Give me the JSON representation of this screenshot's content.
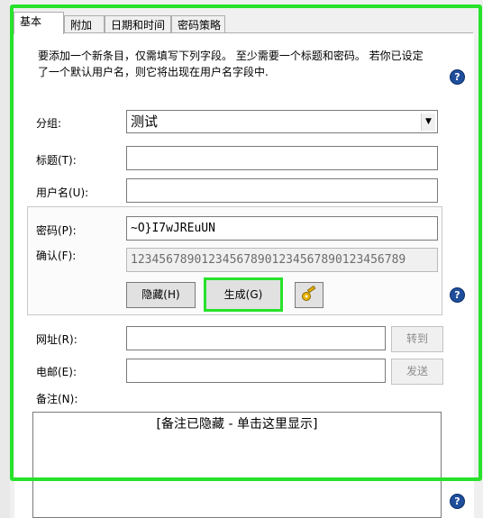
{
  "tabs": [
    {
      "label": "基本"
    },
    {
      "label": "附加"
    },
    {
      "label": "日期和时间"
    },
    {
      "label": "密码策略"
    }
  ],
  "intro": {
    "line1": "要添加一个新条目，仅需填写下列字段。 至少需要一个标题和密码。 若你已设定",
    "line2": "了一个默认用户名，则它将出现在用户名字段中."
  },
  "form": {
    "group_label": "分组:",
    "group_value": "测试",
    "title_label": "标题(T):",
    "title_value": "",
    "username_label": "用户名(U):",
    "username_value": "",
    "password_label": "密码(P):",
    "password_value": "~O}I7wJREuUN",
    "confirm_label": "确认(F):",
    "confirm_value": "123456789012345678901234567890123456789",
    "url_label": "网址(R):",
    "url_value": "",
    "email_label": "电邮(E):",
    "email_value": "",
    "notes_label": "备注(N):",
    "notes_hint": "[备注已隐藏 - 单击这里显示]"
  },
  "buttons": {
    "hide": "隐藏(H)",
    "generate": "生成(G)",
    "goto": "转到",
    "send": "发送"
  },
  "help": {
    "glyph": "?"
  },
  "icons": {
    "key_icon": "key-icon",
    "help_icon": "help-icon"
  },
  "colors": {
    "highlight": "#27e22a",
    "help_blue": "#1f4e9a"
  }
}
